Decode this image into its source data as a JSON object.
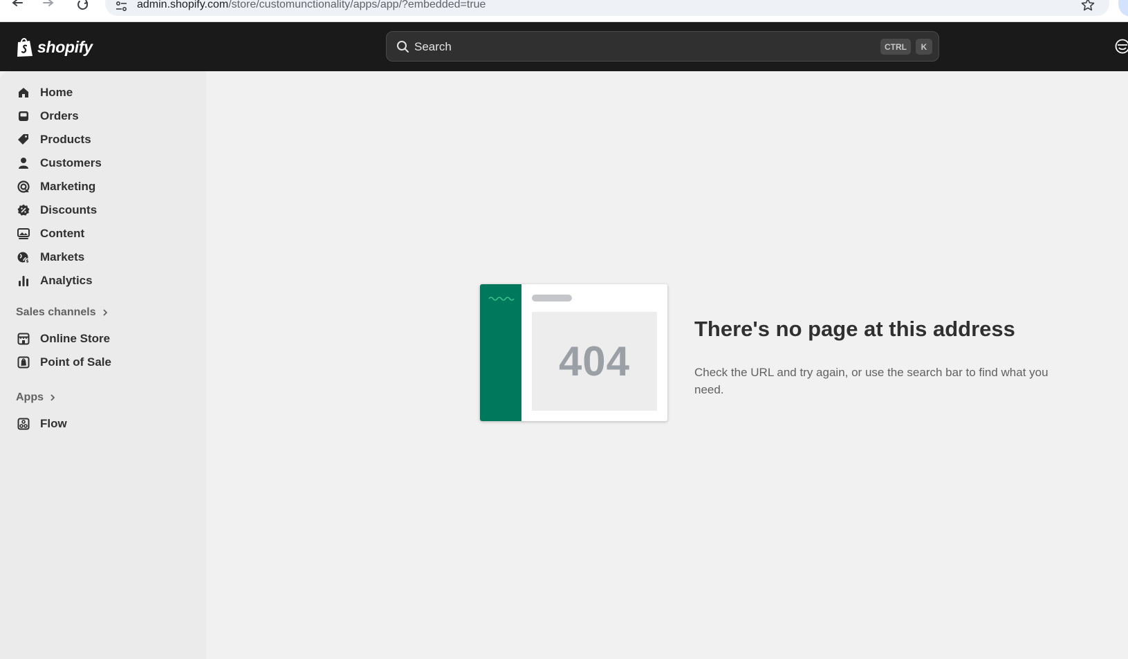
{
  "browser": {
    "url_host": "admin.shopify.com",
    "url_path": "/store/customunctionality/apps/app/?embedded=true"
  },
  "brand": {
    "name": "shopify",
    "color": "#00785c"
  },
  "search": {
    "placeholder": "Search",
    "shortcut_ctrl": "CTRL",
    "shortcut_key": "K"
  },
  "sidebar": {
    "items": [
      {
        "label": "Home",
        "icon": "home-icon"
      },
      {
        "label": "Orders",
        "icon": "inbox-icon"
      },
      {
        "label": "Products",
        "icon": "tag-icon"
      },
      {
        "label": "Customers",
        "icon": "person-icon"
      },
      {
        "label": "Marketing",
        "icon": "target-icon"
      },
      {
        "label": "Discounts",
        "icon": "discount-icon"
      },
      {
        "label": "Content",
        "icon": "image-icon"
      },
      {
        "label": "Markets",
        "icon": "globe-icon"
      },
      {
        "label": "Analytics",
        "icon": "bar-chart-icon"
      }
    ],
    "sales_channels": {
      "title": "Sales channels",
      "items": [
        {
          "label": "Online Store",
          "icon": "store-icon"
        },
        {
          "label": "Point of Sale",
          "icon": "pos-icon"
        }
      ]
    },
    "apps": {
      "title": "Apps",
      "items": [
        {
          "label": "Flow",
          "icon": "flow-icon"
        }
      ]
    }
  },
  "error": {
    "code": "404",
    "title": "There's no page at this address",
    "message": "Check the URL and try again, or use the search bar to find what you need."
  }
}
